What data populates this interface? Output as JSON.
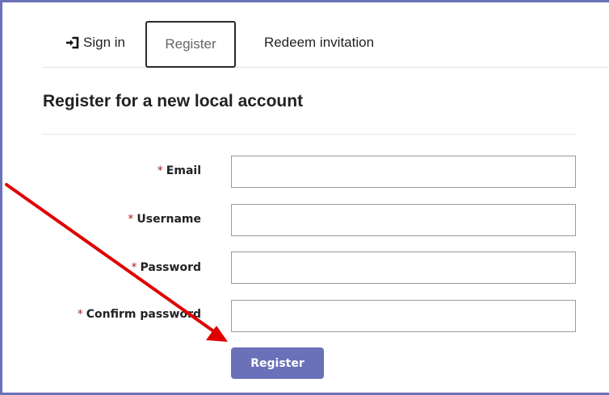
{
  "tabs": {
    "sign_in": "Sign in",
    "register": "Register",
    "redeem": "Redeem invitation",
    "active": "register"
  },
  "page_title": "Register for a new local account",
  "form": {
    "required_marker": "*",
    "fields": [
      {
        "label": "Email",
        "value": "",
        "placeholder": ""
      },
      {
        "label": "Username",
        "value": "",
        "placeholder": ""
      },
      {
        "label": "Password",
        "value": "",
        "placeholder": ""
      },
      {
        "label": "Confirm password",
        "value": "",
        "placeholder": ""
      }
    ],
    "submit_label": "Register"
  },
  "icons": {
    "sign_in": "sign-in-icon"
  },
  "colors": {
    "frame": "#6b72b8",
    "button": "#6a71b8",
    "required": "#a22222",
    "arrow": "#e00000"
  }
}
